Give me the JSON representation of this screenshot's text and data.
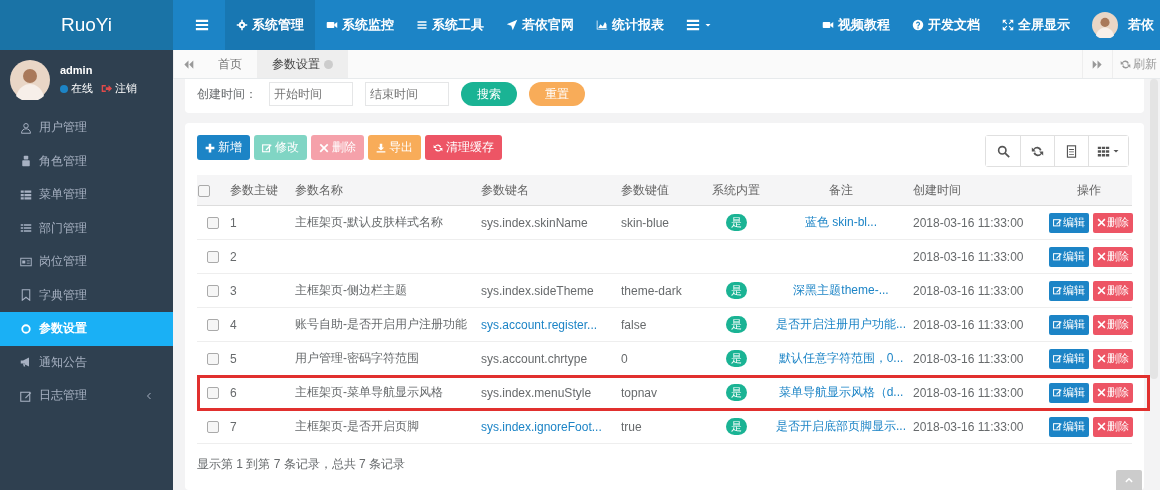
{
  "header": {
    "logo": "RuoYi",
    "nav_items": [
      {
        "label": "系统管理",
        "selected": true
      },
      {
        "label": "系统监控",
        "selected": false
      },
      {
        "label": "系统工具",
        "selected": false
      },
      {
        "label": "若依官网",
        "selected": false
      },
      {
        "label": "统计报表",
        "selected": false
      }
    ],
    "right_items": [
      {
        "label": "视频教程"
      },
      {
        "label": "开发文档"
      },
      {
        "label": "全屏显示"
      }
    ],
    "user": {
      "name": "若依"
    }
  },
  "sidebar": {
    "user": {
      "name": "admin",
      "status": "在线",
      "logout": "注销"
    },
    "items": [
      {
        "label": "用户管理",
        "selected": false,
        "expandable": false
      },
      {
        "label": "角色管理",
        "selected": false,
        "expandable": false
      },
      {
        "label": "菜单管理",
        "selected": false,
        "expandable": false
      },
      {
        "label": "部门管理",
        "selected": false,
        "expandable": false
      },
      {
        "label": "岗位管理",
        "selected": false,
        "expandable": false
      },
      {
        "label": "字典管理",
        "selected": false,
        "expandable": false
      },
      {
        "label": "参数设置",
        "selected": true,
        "expandable": false
      },
      {
        "label": "通知公告",
        "selected": false,
        "expandable": false
      },
      {
        "label": "日志管理",
        "selected": false,
        "expandable": true
      }
    ]
  },
  "tabs": {
    "items": [
      {
        "label": "首页",
        "selected": false,
        "closable": false
      },
      {
        "label": "参数设置",
        "selected": true,
        "closable": true
      }
    ],
    "refresh": "刷新"
  },
  "search": {
    "label": "创建时间：",
    "fields": [
      {
        "placeholder": "开始时间"
      },
      {
        "placeholder": "结束时间"
      }
    ],
    "buttons": [
      {
        "label": "搜索",
        "kind": "search"
      },
      {
        "label": "重置",
        "kind": "reset"
      }
    ]
  },
  "toolbar": {
    "buttons": [
      {
        "label": "新增",
        "kind": "add",
        "disabled": false
      },
      {
        "label": "修改",
        "kind": "edit",
        "disabled": true
      },
      {
        "label": "删除",
        "kind": "remove",
        "disabled": true
      },
      {
        "label": "导出",
        "kind": "export",
        "disabled": false
      },
      {
        "label": "清理缓存",
        "kind": "clear",
        "disabled": false
      }
    ]
  },
  "table": {
    "all_checked": false,
    "columns": [
      "参数主键",
      "参数名称",
      "参数键名",
      "参数键值",
      "系统内置",
      "备注",
      "创建时间",
      "操作"
    ],
    "rows": [
      {
        "checked": false,
        "highlighted": false,
        "id": "1",
        "name": "主框架页-默认皮肤样式名称",
        "key": "sys.index.skinName",
        "key_link": false,
        "value": "skin-blue",
        "builtin": "是",
        "remark": "蓝色 skin-bl...",
        "created": "2018-03-16 11:33:00",
        "actions": [
          "编辑",
          "删除"
        ]
      },
      {
        "checked": false,
        "highlighted": false,
        "id": "2",
        "created": "2018-03-16 11:33:00",
        "actions": [
          "编辑",
          "删除"
        ]
      },
      {
        "checked": false,
        "highlighted": false,
        "id": "3",
        "name": "主框架页-侧边栏主题",
        "key": "sys.index.sideTheme",
        "key_link": false,
        "value": "theme-dark",
        "builtin": "是",
        "remark": "深黑主题theme-...",
        "created": "2018-03-16 11:33:00",
        "actions": [
          "编辑",
          "删除"
        ]
      },
      {
        "checked": false,
        "highlighted": false,
        "id": "4",
        "name": "账号自助-是否开启用户注册功能",
        "key": "sys.account.register...",
        "key_link": true,
        "value": "false",
        "builtin": "是",
        "remark": "是否开启注册用户功能...",
        "created": "2018-03-16 11:33:00",
        "actions": [
          "编辑",
          "删除"
        ]
      },
      {
        "checked": false,
        "highlighted": false,
        "id": "5",
        "name": "用户管理-密码字符范围",
        "key": "sys.account.chrtype",
        "key_link": false,
        "value": "0",
        "builtin": "是",
        "remark": "默认任意字符范围，0...",
        "created": "2018-03-16 11:33:00",
        "actions": [
          "编辑",
          "删除"
        ]
      },
      {
        "checked": false,
        "highlighted": true,
        "id": "6",
        "name": "主框架页-菜单导航显示风格",
        "key": "sys.index.menuStyle",
        "key_link": false,
        "value": "topnav",
        "builtin": "是",
        "remark": "菜单导航显示风格（d...",
        "created": "2018-03-16 11:33:00",
        "actions": [
          "编辑",
          "删除"
        ]
      },
      {
        "checked": false,
        "highlighted": false,
        "id": "7",
        "name": "主框架页-是否开启页脚",
        "key": "sys.index.ignoreFoot...",
        "key_link": true,
        "value": "true",
        "builtin": "是",
        "remark": "是否开启底部页脚显示...",
        "created": "2018-03-16 11:33:00",
        "actions": [
          "编辑",
          "删除"
        ]
      }
    ]
  },
  "pagination": {
    "summary": "显示第 1 到第 7 条记录，总共 7 条记录"
  }
}
